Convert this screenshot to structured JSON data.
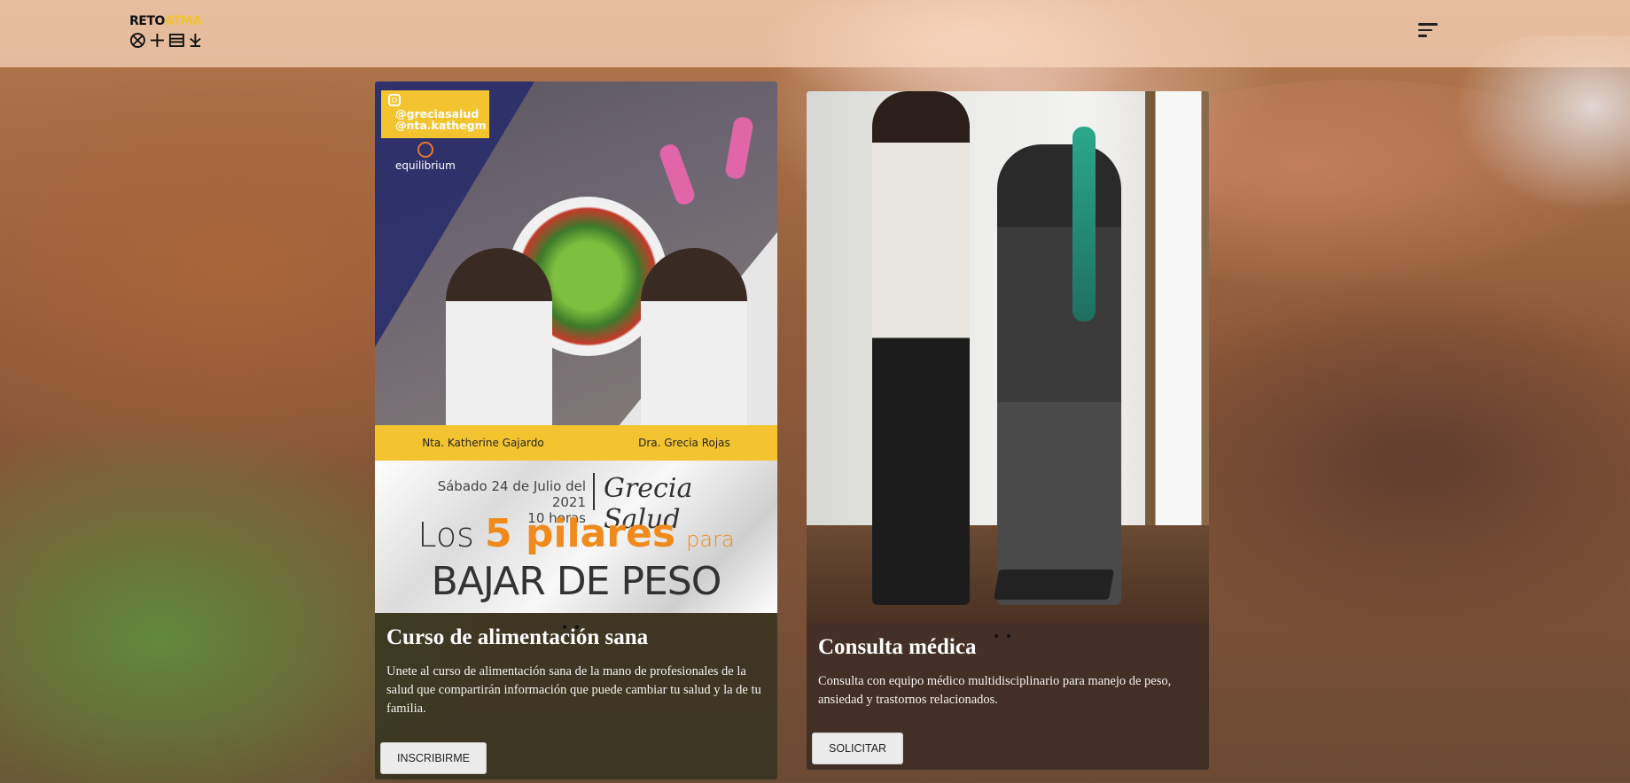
{
  "header": {
    "logo": {
      "text_dark": "RETO",
      "text_accent": "ATMA"
    },
    "menu_icon": "hamburger-menu-icon"
  },
  "cards": [
    {
      "title": "Curso de alimentación sana",
      "text": "Unete al curso de alimentación sana de la mano de profesionales de la salud que compartirán información que puede cambiar tu salud y la de tu familia.",
      "button": "INSCRIBIRME",
      "poster": {
        "handles": [
          "@greciasalud",
          "@nta.kathegm"
        ],
        "brand": "equilibrium",
        "names": [
          "Nta. Katherine Gajardo",
          "Dra. Grecia Rojas"
        ],
        "date": "Sábado 24 de Julio del 2021",
        "time": "10 horas",
        "signature": "Grecia Salud",
        "headline_pre": "Los",
        "headline_highlight": "5 pilares",
        "headline_small": "para",
        "headline_line2": "BAJAR DE PESO"
      }
    },
    {
      "title": "Consulta médica",
      "text": "Consulta con equipo médico multidisciplinario para manejo de peso, ansiedad y trastornos relacionados.",
      "button": "SOLICITAR"
    }
  ],
  "colors": {
    "accent": "#f4c430",
    "headline_orange": "#f08a1c",
    "header_bg": "#fad7be"
  }
}
